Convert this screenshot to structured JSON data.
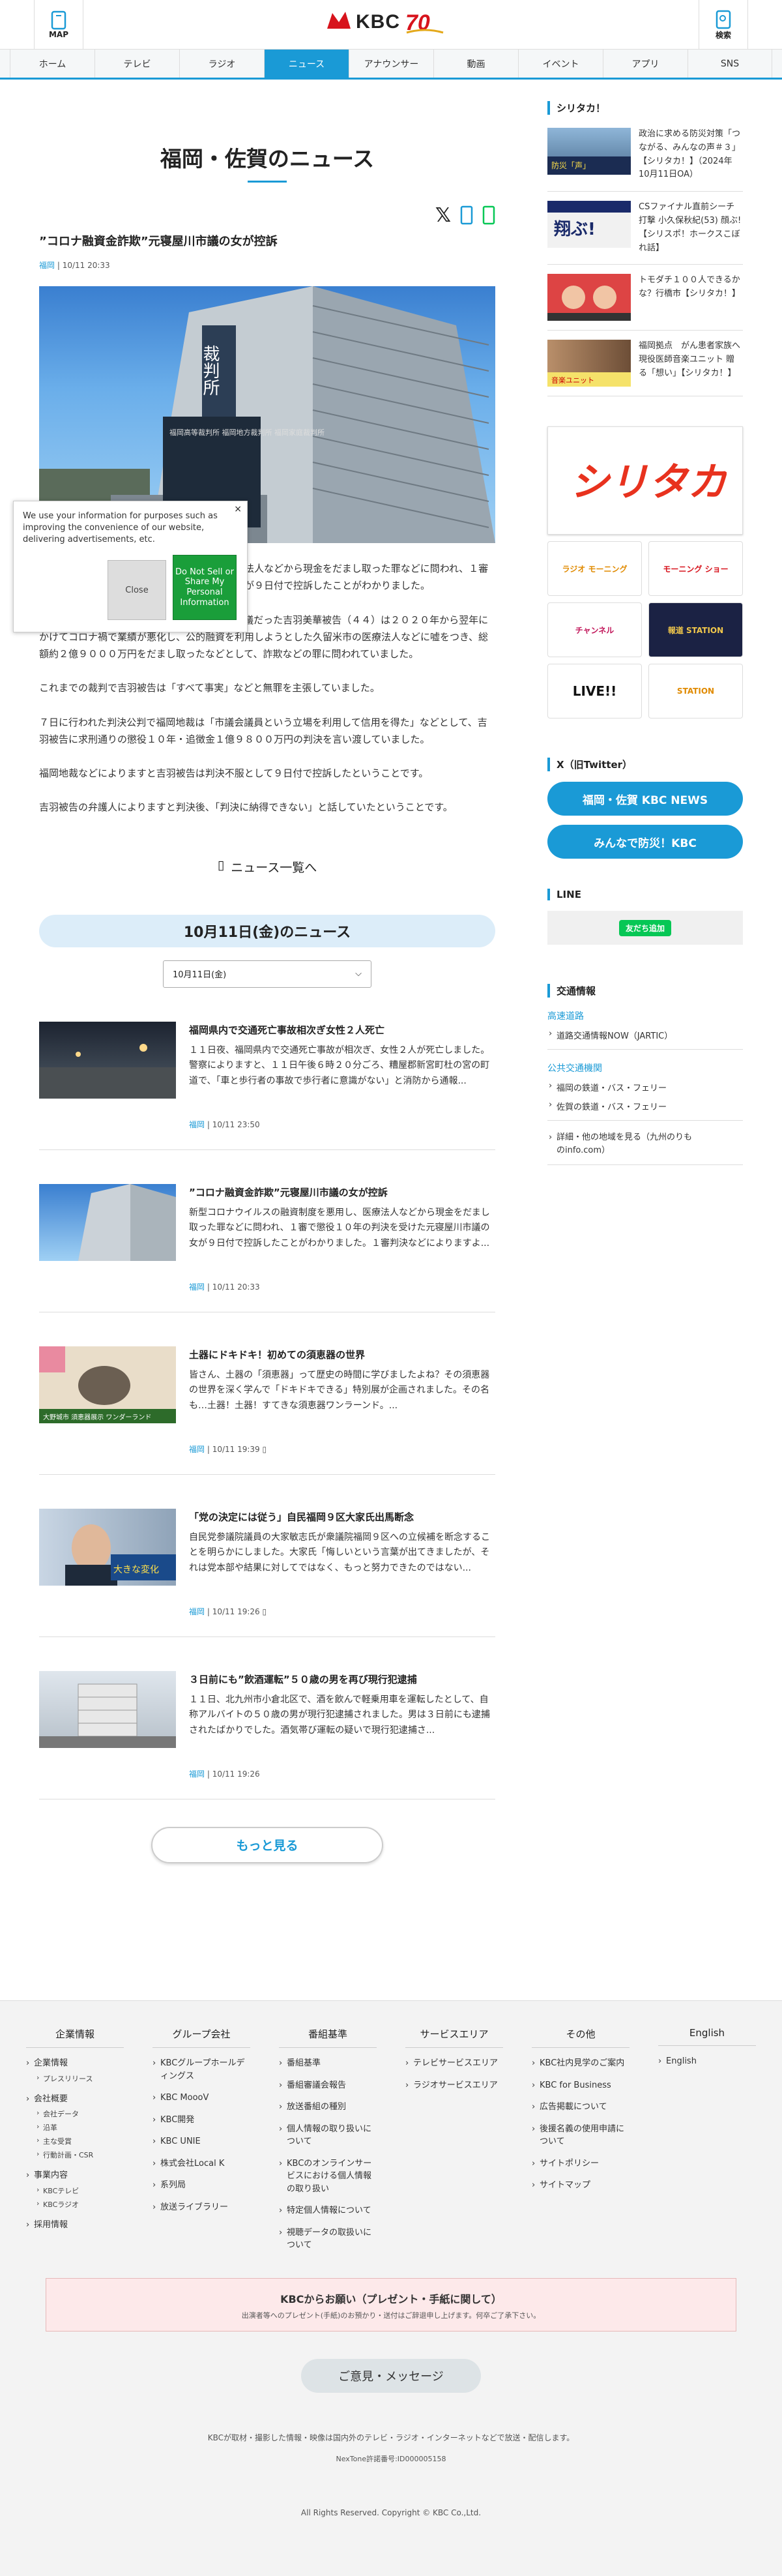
{
  "header": {
    "menu_label": "MAP",
    "search_label": "検索",
    "logo_text": "KBC",
    "anniv_text": "70"
  },
  "nav": [
    "ホーム",
    "テレビ",
    "ラジオ",
    "ニュース",
    "アナウンサー",
    "動画",
    "イベント",
    "アプリ",
    "SNS"
  ],
  "page_title": "福岡・佐賀のニュース",
  "article": {
    "title": "”コロナ融資金詐欺”元寝屋川市議の女が控訴",
    "category": "福岡",
    "date": "10/11 20:33",
    "hero_sign": "裁判所",
    "hero_plates": "福岡高等裁判所 福岡地方裁判所 福岡家庭裁判所",
    "p1": "新型コロナウイルスの融資制度を悪用し、医療法人などから現金をだまし取った罪などに問われ、１審で懲役１０年の判決を受けた元寝屋川市議の女が９日付で控訴したことがわかりました。",
    "p2": "１審判決などによりますと、大阪府の寝屋川市議だった吉羽美華被告（４４）は２０２０年から翌年にかけてコロナ禍で業績が悪化し、公的融資を利用しようとした久留米市の医療法人などに嘘をつき、総額約２億９０００万円をだまし取ったなどとして、詐欺などの罪に問われていました。",
    "p3": "これまでの裁判で吉羽被告は「すべて事実」などと無罪を主張していました。",
    "p4": "７日に行われた判決公判で福岡地裁は「市議会議員という立場を利用して信用を得た」などとして、吉羽被告に求刑通りの懲役１０年・追徴金１億９８００万円の判決を言い渡していました。",
    "p5": "福岡地裁などによりますと吉羽被告は判決不服として９日付で控訴したということです。",
    "p6": "吉羽被告の弁護人によりますと判決後、「判決に納得できない」と話していたということです。"
  },
  "news_list_label": "ニュース一覧へ",
  "date_header": "10月11日(金)のニュース",
  "date_select": "10月11日(金)",
  "items": [
    {
      "title": "福岡県内で交通死亡事故相次ぎ女性２人死亡",
      "desc": "１１日夜、福岡県内で交通死亡事故が相次ぎ、女性２人が死亡しました。警察によりますと、１１日午後６時２０分ごろ、糟屋郡新宮町杜の宮の町道で、「車と歩行者の事故で歩行者に意識がない」と消防から通報...",
      "cat": "福岡",
      "date": "10/11 23:50"
    },
    {
      "title": "”コロナ融資金詐欺”元寝屋川市議の女が控訴",
      "desc": "新型コロナウイルスの融資制度を悪用し、医療法人などから現金をだまし取った罪などに問われ、１審で懲役１０年の判決を受けた元寝屋川市議の女が９日付で控訴したことがわかりました。１審判決などによりますよ...",
      "cat": "福岡",
      "date": "10/11 20:33"
    },
    {
      "title": "土器にドキドキ！初めての須恵器の世界",
      "desc": "皆さん、土器の「須恵器」って歴史の時間に学びましたよね？その須恵器の世界を深く学んで「ドキドキできる」特別展が企画されました。その名も…土器！土器！すてきな須恵器ワンラーンド。...",
      "cat": "福岡",
      "date": "10/11 19:39",
      "thumb_caption": "大野城市 須恵器展示 ワンダーランド"
    },
    {
      "title": "「党の決定には従う」自民福岡９区大家氏出馬断念",
      "desc": "自民党参議院議員の大家敏志氏が衆議院福岡９区への立候補を断念することを明らかにしました。大家氏「悔しいという言葉が出てきましたが、それは党本部や結果に対してではなく、もっと努力できたのではない...",
      "cat": "福岡",
      "date": "10/11 19:26",
      "thumb_caption": "大きな変化"
    },
    {
      "title": "３日前にも”飲酒運転”５０歳の男を再び現行犯逮捕",
      "desc": "１１日、北九州市小倉北区で、酒を飲んで軽乗用車を運転したとして、自称アルバイトの５０歳の男が現行犯逮捕されました。男は３日前にも逮捕されたばかりでした。酒気帯び運転の疑いで現行犯逮捕さ...",
      "cat": "福岡",
      "date": "10/11 19:26"
    }
  ],
  "more_label": "もっと見る",
  "consent": {
    "text": "We use your information for purposes such as improving the convenience of our website, delivering advertisements, etc.",
    "close": "Close",
    "dns": "Do Not Sell or Share My Personal Information",
    "x": "×"
  },
  "sidebar": {
    "shiritaka_head": "シリタカ！",
    "items": [
      {
        "text": "政治に求める防災対策「つながる、みんなの声＃３」【シリタカ！】（2024年10月11日OA）",
        "img": "防災「声」"
      },
      {
        "text": "CSファイナル直前シーチ打撃 小久保秋紀(53) 顔ぶ!【シリスポ！ホークスこぼれ話】",
        "img": "翔ぶ!"
      },
      {
        "text": "トモダチ１００人できるかな？行橋市【シリタカ！】",
        "img": ""
      },
      {
        "text": "福岡拠点　がん患者家族へ 現役医師音楽ユニット 贈る「想い」【シリタカ！】",
        "img": "音楽ユニット"
      }
    ],
    "banner_main": "シリタカ!",
    "banners": [
      "ラジオ モーニング",
      "モーニング ショー",
      "チャンネル",
      "報道 STATION",
      "LIVE!!",
      "STATION"
    ],
    "twitter_head": "X（旧Twitter）",
    "tw1": "福岡・佐賀 KBC NEWS",
    "tw2": "みんなで防災！KBC",
    "line_head": "LINE",
    "line_btn": "友だち追加",
    "traffic_head": "交通情報",
    "t_cat1": "高速道路",
    "t_li1": "道路交通情報NOW（JARTIC）",
    "t_cat2": "公共交通機関",
    "t_li2": "福岡の鉄道・バス・フェリー",
    "t_li3": "佐賀の鉄道・バス・フェリー",
    "t_li4": "詳細・他の地域を見る（九州のりものinfo.com）"
  },
  "footer": {
    "cols": [
      {
        "h": "企業情報",
        "items": [
          {
            "t": "企業情報",
            "subs": [
              "プレスリリース"
            ]
          },
          {
            "t": "会社概要",
            "subs": [
              "会社データ",
              "沿革",
              "主な受賞",
              "行動計画・CSR"
            ]
          },
          {
            "t": "事業内容",
            "subs": [
              "KBCテレビ",
              "KBCラジオ"
            ]
          },
          {
            "t": "採用情報",
            "subs": []
          }
        ]
      },
      {
        "h": "グループ会社",
        "items": [
          {
            "t": "KBCグループホールディングス",
            "subs": []
          },
          {
            "t": "KBC MoooV",
            "subs": []
          },
          {
            "t": "KBC開発",
            "subs": []
          },
          {
            "t": "KBC UNIE",
            "subs": []
          },
          {
            "t": "株式会社Local K",
            "subs": []
          },
          {
            "t": "系列局",
            "subs": []
          },
          {
            "t": "放送ライブラリー",
            "subs": []
          }
        ]
      },
      {
        "h": "番組基準",
        "items": [
          {
            "t": "番組基準",
            "subs": []
          },
          {
            "t": "番組審議会報告",
            "subs": []
          },
          {
            "t": "放送番組の種別",
            "subs": []
          },
          {
            "t": "個人情報の取り扱いについて",
            "subs": []
          },
          {
            "t": "KBCのオンラインサービスにおける個人情報の取り扱い",
            "subs": []
          },
          {
            "t": "特定個人情報について",
            "subs": []
          },
          {
            "t": "視聴データの取扱いについて",
            "subs": []
          }
        ]
      },
      {
        "h": "サービスエリア",
        "items": [
          {
            "t": "テレビサービスエリア",
            "subs": []
          },
          {
            "t": "ラジオサービスエリア",
            "subs": []
          }
        ]
      },
      {
        "h": "その他",
        "items": [
          {
            "t": "KBC社内見学のご案内",
            "subs": []
          },
          {
            "t": "KBC for Business",
            "subs": []
          },
          {
            "t": "広告掲載について",
            "subs": []
          },
          {
            "t": "後援名義の使用申請について",
            "subs": []
          },
          {
            "t": "サイトポリシー",
            "subs": []
          },
          {
            "t": "サイトマップ",
            "subs": []
          }
        ]
      },
      {
        "h": "English",
        "items": [
          {
            "t": "English",
            "subs": []
          }
        ]
      }
    ],
    "ask_title": "KBCからお願い（プレゼント・手紙に関して）",
    "ask_text": "出演者等へのプレゼント(手紙)のお預かり・送付はご辞退申し上げます。何卒ご了承下さい。",
    "msg": "ご意見・メッセージ",
    "note1": "KBCが取材・撮影した情報・映像は国内外のテレビ・ラジオ・インターネットなどで放送・配信します。",
    "note2": "NexTone許諾番号:ID000005158",
    "copy": "All Rights Reserved. Copyright © KBC Co.,Ltd."
  },
  "colors": {
    "accent": "#1a9ad6",
    "brand_red": "#d7131c",
    "line_green": "#06c755"
  }
}
